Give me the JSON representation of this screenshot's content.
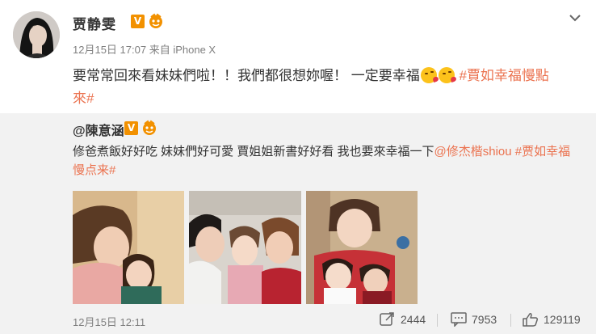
{
  "post": {
    "author_name": "贾静雯",
    "verified_badge": "V",
    "timestamp": "12月15日 17:07",
    "source_prefix": "来自",
    "source": "iPhone X",
    "text": "要常常回來看妹妹們啦！！我們都很想妳喔！ 一定要幸福",
    "emoji_icon": "kiss-emoji-icon",
    "hashtag_line1": "#賈如幸福慢點",
    "hashtag_line2": "來#"
  },
  "repost": {
    "author": "@陳意涵",
    "verified_badge": "V",
    "text_line1": "修爸煮飯好好吃 妹妹們好可愛 賈姐姐新書好好看 我也要來幸福一下",
    "mention": "@修杰楷shiou",
    "hashtag_line1": "#贾如幸福",
    "hashtag_line2": "慢点来#",
    "date": "12月15日 12:11",
    "reposts": "2444",
    "comments": "7953",
    "likes": "129119"
  },
  "colors": {
    "accent": "#eb7350",
    "badge": "#f29100",
    "repost_bg": "#f2f2f2"
  }
}
